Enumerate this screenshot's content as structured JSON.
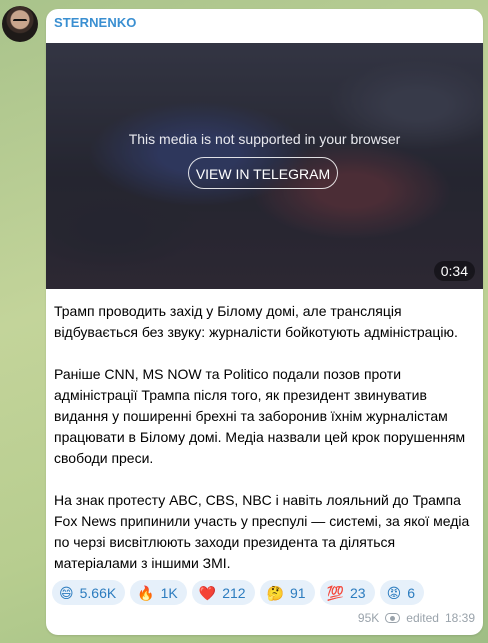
{
  "channel": {
    "name": "STERNENKO"
  },
  "media": {
    "unsupported_message": "This media is not supported in your browser",
    "view_button_label": "VIEW IN TELEGRAM",
    "duration": "0:34"
  },
  "post": {
    "paragraphs": [
      "Трамп проводить захід у Білому домі, але трансляція відбувається без звуку: журналісти бойкотують адміністрацію.",
      "Раніше CNN, MS NOW та Politico подали позов проти адміністрації Трампа після того, як президент звинуватив видання у поширенні брехні та заборонив їхнім журналістам працювати в Білому домі. Медіа назвали цей крок порушенням свободи преси.",
      "На знак протесту ABC, CBS, NBC і навіть лояльний до Трампа Fox News припинили участь у преспулі — системі, за якої медіа по черзі висвітлюють заходи президента та діляться матеріалами з іншими ЗМІ."
    ]
  },
  "reactions": [
    {
      "emoji": "😄",
      "icon": "grinning-face-icon",
      "count": "5.66K"
    },
    {
      "emoji": "🔥",
      "icon": "fire-icon",
      "count": "1K"
    },
    {
      "emoji": "❤️",
      "icon": "heart-icon",
      "count": "212"
    },
    {
      "emoji": "🤔",
      "icon": "thinking-face-icon",
      "count": "91"
    },
    {
      "emoji": "💯",
      "icon": "hundred-points-icon",
      "count": "23"
    },
    {
      "emoji": "😡",
      "icon": "angry-face-icon",
      "count": "6"
    }
  ],
  "meta": {
    "views": "95K",
    "edited_label": "edited",
    "time": "18:39"
  },
  "colors": {
    "accent": "#3a8fd1",
    "reaction_bg": "#e6f0fa",
    "background": "#b7cd8f"
  }
}
